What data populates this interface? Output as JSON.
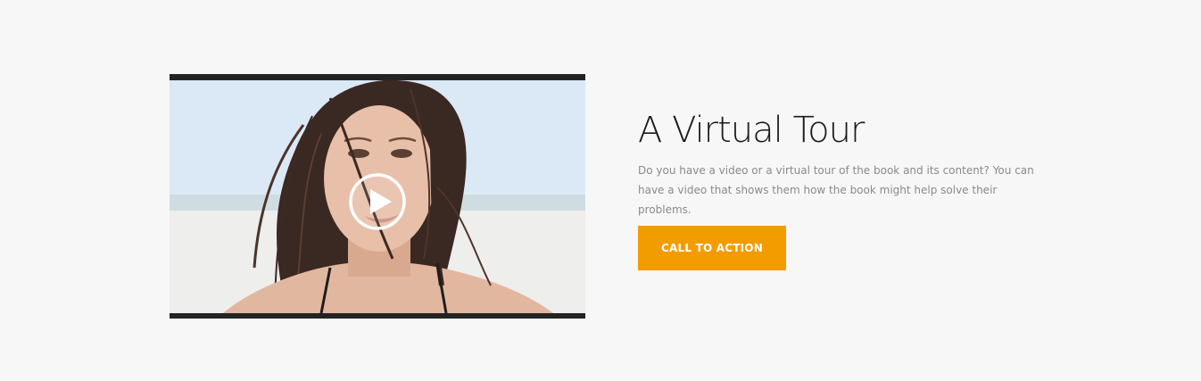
{
  "video": {
    "thumbnail_icon": "play-icon"
  },
  "content": {
    "title": "A Virtual Tour",
    "description": "Do you have a video or a virtual tour of the book and its content? You can have a video that shows them how the book might help solve their problems.",
    "cta_label": "CALL TO ACTION"
  },
  "colors": {
    "background": "#f7f7f7",
    "accent": "#f39c00",
    "title": "#1b1b1b",
    "body_text": "#8a8a8a",
    "video_border": "#232323"
  }
}
